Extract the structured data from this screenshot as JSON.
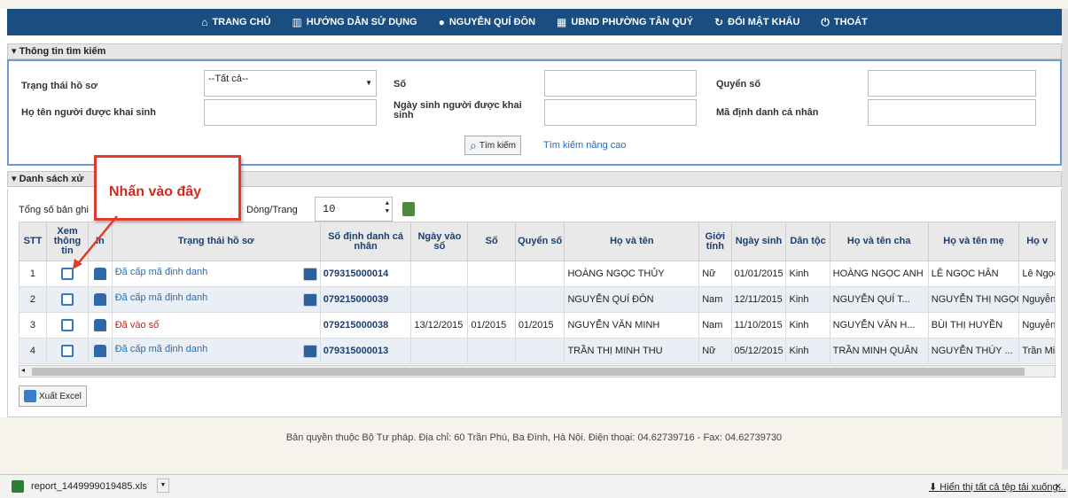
{
  "nav": {
    "items": [
      {
        "label": "TRANG CHỦ",
        "icon": "home-icon"
      },
      {
        "label": "HƯỚNG DẪN SỬ DỤNG",
        "icon": "book-icon"
      },
      {
        "label": "NGUYỄN QUÍ ĐÔN",
        "icon": "user-icon"
      },
      {
        "label": "UBND PHƯỜNG TÂN QUÝ",
        "icon": "building-icon"
      },
      {
        "label": "ĐỔI MẬT KHẨU",
        "icon": "refresh-icon"
      },
      {
        "label": "THOÁT",
        "icon": "power-icon"
      }
    ]
  },
  "search": {
    "panel_title": "Thông tin tìm kiếm",
    "status_label": "Trạng thái hồ sơ",
    "status_value": "--Tất cả--",
    "so_label": "Số",
    "quyen_so_label": "Quyển số",
    "name_label": "Họ tên người được khai sinh",
    "dob_label_line1": "Ngày sinh người được khai",
    "dob_label_line2": "sinh",
    "id_label": "Mã định danh cá nhân",
    "search_button": "Tìm kiếm",
    "advanced_link": "Tìm kiếm nâng cao"
  },
  "list": {
    "panel_title": "Danh sách xử",
    "total_label": "Tổng số bản ghi",
    "rows_per_page_label": "Dòng/Trang",
    "rows_per_page_value": "10",
    "columns": [
      "STT",
      "Xem thông tin",
      "In",
      "Trạng thái hồ sơ",
      "Số định danh cá nhân",
      "Ngày vào sổ",
      "Số",
      "Quyển số",
      "Họ và tên",
      "Giới tính",
      "Ngày sinh",
      "Dân tộc",
      "Họ và tên cha",
      "Họ và tên mẹ",
      "Họ v"
    ],
    "rows": [
      {
        "stt": "1",
        "status": "Đã cấp mã định danh",
        "id": "079315000014",
        "ngay_vao_so": "",
        "so": "",
        "quyen": "",
        "name": "HOÀNG NGỌC THỦY",
        "gender": "Nữ",
        "dob": "01/01/2015",
        "ethnic": "Kinh",
        "father": "HOÀNG NGỌC ANH",
        "mother": "LÊ NGỌC HÂN",
        "extra": "Lê Ngọc"
      },
      {
        "stt": "2",
        "status": "Đã cấp mã định danh",
        "id": "079215000039",
        "ngay_vao_so": "",
        "so": "",
        "quyen": "",
        "name": "NGUYỄN QUÍ ĐÔN",
        "gender": "Nam",
        "dob": "12/11/2015",
        "ethnic": "Kinh",
        "father": "NGUYỄN QUÍ T...",
        "mother": "NGUYỄN THỊ NGỌC",
        "extra": "Nguyễn"
      },
      {
        "stt": "3",
        "status": "Đã vào sổ",
        "id": "079215000038",
        "ngay_vao_so": "13/12/2015",
        "so": "01/2015",
        "quyen": "01/2015",
        "name": "NGUYỄN VĂN MINH",
        "gender": "Nam",
        "dob": "11/10/2015",
        "ethnic": "Kinh",
        "father": "NGUYỄN VĂN H...",
        "mother": "BÙI THỊ HUYỀN",
        "extra": "Nguyễn"
      },
      {
        "stt": "4",
        "status": "Đã cấp mã định danh",
        "id": "079315000013",
        "ngay_vao_so": "",
        "so": "",
        "quyen": "",
        "name": "TRẦN THỊ MINH THU",
        "gender": "Nữ",
        "dob": "05/12/2015",
        "ethnic": "Kinh",
        "father": "TRẦN MINH QUÂN",
        "mother": "NGUYỄN THÚY ...",
        "extra": "Trần Mi"
      }
    ],
    "export_button": "Xuất Excel"
  },
  "callout": "Nhấn vào đây",
  "footer": "Bản quyền thuộc Bộ Tư pháp. Địa chỉ: 60 Trần Phú, Ba Đình, Hà Nội. Điện thoại: 04.62739716 - Fax: 04.62739730",
  "download": {
    "filename": "report_1449999019485.xls",
    "show_all": "Hiển thị tất cả tệp tải xuống...",
    "close": "×"
  },
  "colors": {
    "nav_bg": "#1a4d80",
    "callout_border": "#e03a2f",
    "link": "#2a6bb0",
    "status_red": "#c0201a"
  }
}
